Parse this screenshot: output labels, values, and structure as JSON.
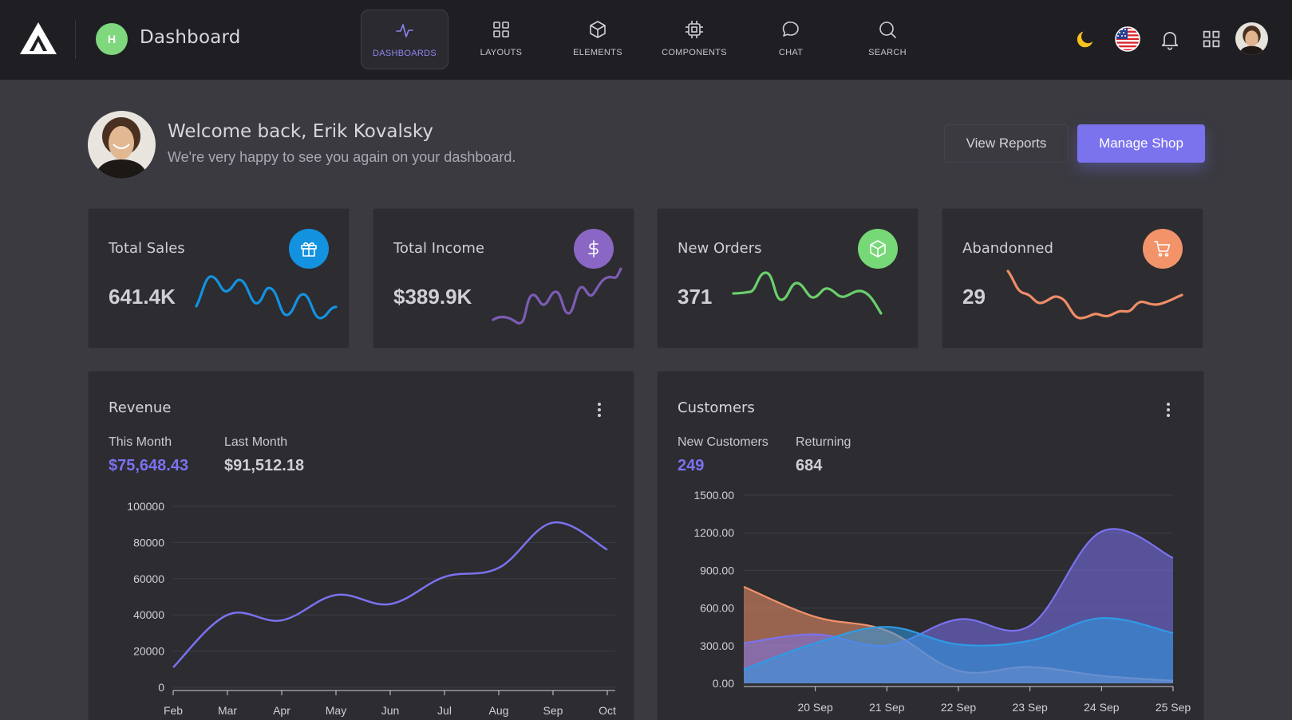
{
  "header": {
    "app_initial": "H",
    "title": "Dashboard",
    "nav": [
      {
        "label": "DASHBOARDS",
        "icon": "activity-icon",
        "active": true
      },
      {
        "label": "LAYOUTS",
        "icon": "grid-icon",
        "active": false
      },
      {
        "label": "ELEMENTS",
        "icon": "cube-icon",
        "active": false
      },
      {
        "label": "COMPONENTS",
        "icon": "chip-icon",
        "active": false
      },
      {
        "label": "CHAT",
        "icon": "chat-bubble-icon",
        "active": false
      },
      {
        "label": "SEARCH",
        "icon": "search-icon",
        "active": false
      }
    ],
    "right_icons": [
      "moon-icon",
      "us-flag-icon",
      "bell-icon",
      "apps-grid-icon",
      "user-avatar"
    ]
  },
  "welcome": {
    "title": "Welcome back, Erik Kovalsky",
    "subtitle": "We're very happy to see you again on your dashboard.",
    "view_reports_label": "View Reports",
    "manage_shop_label": "Manage Shop"
  },
  "stats": [
    {
      "title": "Total Sales",
      "value": "641.4K",
      "icon": "gift-icon",
      "color": "#1392e0"
    },
    {
      "title": "Total Income",
      "value": "$389.9K",
      "icon": "dollar-icon",
      "color": "#8a67c4"
    },
    {
      "title": "New Orders",
      "value": "371",
      "icon": "box-icon",
      "color": "#77d877"
    },
    {
      "title": "Abandonned",
      "value": "29",
      "icon": "cart-icon",
      "color": "#f2936a"
    }
  ],
  "revenue": {
    "title": "Revenue",
    "this_month_label": "This Month",
    "this_month_value": "$75,648.43",
    "last_month_label": "Last Month",
    "last_month_value": "$91,512.18"
  },
  "customers": {
    "title": "Customers",
    "new_label": "New Customers",
    "new_value": "249",
    "returning_label": "Returning",
    "returning_value": "684"
  },
  "chart_data": [
    {
      "type": "line",
      "title": "Revenue",
      "categories": [
        "Feb",
        "Mar",
        "Apr",
        "May",
        "Jun",
        "Jul",
        "Aug",
        "Sep",
        "Oct"
      ],
      "y_ticks": [
        "0",
        "20000",
        "40000",
        "60000",
        "80000",
        "100000"
      ],
      "ylim": [
        0,
        100000
      ],
      "series": [
        {
          "values": [
            11000,
            40000,
            37000,
            51000,
            46000,
            61000,
            66000,
            91000,
            76000
          ],
          "color": "#7b72ee"
        }
      ],
      "grid": true
    },
    {
      "type": "area",
      "title": "Customers",
      "categories": [
        "20 Sep",
        "21 Sep",
        "22 Sep",
        "23 Sep",
        "24 Sep",
        "25 Sep"
      ],
      "y_ticks": [
        "0.00",
        "300.00",
        "600.00",
        "900.00",
        "1200.00",
        "1500.00"
      ],
      "ylim": [
        0,
        1500
      ],
      "series": [
        {
          "values": [
            770,
            530,
            420,
            100,
            130,
            60,
            20
          ],
          "color": "#f2936a"
        },
        {
          "values": [
            320,
            390,
            300,
            510,
            460,
            1210,
            1000
          ],
          "color": "#7b72ee"
        },
        {
          "values": [
            110,
            320,
            450,
            310,
            340,
            520,
            400
          ],
          "color": "#2e9be6"
        }
      ],
      "grid": true
    }
  ]
}
